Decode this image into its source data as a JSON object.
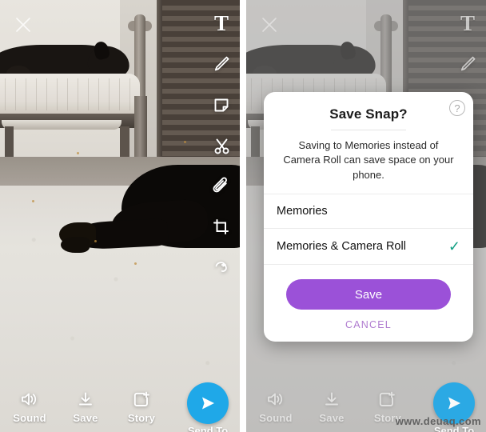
{
  "panels": {
    "left": {
      "name": "Snap editor",
      "close_icon": "close-x-icon",
      "tools": [
        {
          "id": "text",
          "icon": "text-tool-icon",
          "glyph": "T"
        },
        {
          "id": "draw",
          "icon": "pencil-icon"
        },
        {
          "id": "sticker",
          "icon": "sticker-icon"
        },
        {
          "id": "scissors",
          "icon": "scissors-icon"
        },
        {
          "id": "attach",
          "icon": "paperclip-icon"
        },
        {
          "id": "crop",
          "icon": "crop-icon"
        },
        {
          "id": "loop",
          "icon": "loop-icon"
        }
      ],
      "bottom": {
        "items": [
          {
            "id": "sound",
            "label": "Sound",
            "icon": "speaker-icon"
          },
          {
            "id": "save",
            "label": "Save",
            "icon": "download-icon"
          },
          {
            "id": "story",
            "label": "Story",
            "icon": "add-to-story-icon"
          }
        ],
        "send": {
          "label": "Send To",
          "icon": "send-arrow-icon",
          "color": "#1FA8E8"
        }
      }
    },
    "right": {
      "name": "Snap editor with Save Snap dialog",
      "dialog": {
        "title": "Save Snap?",
        "subtitle": "Saving to Memories instead of Camera Roll can save space on your phone.",
        "help_icon": "question-mark-icon",
        "help_glyph": "?",
        "options": [
          {
            "label": "Memories",
            "selected": false
          },
          {
            "label": "Memories & Camera Roll",
            "selected": true,
            "check_glyph": "✓"
          }
        ],
        "save_label": "Save",
        "cancel_label": "CANCEL",
        "colors": {
          "save_button": "#9B51D8",
          "cancel_text": "#B07CD0",
          "check": "#16A085"
        }
      }
    }
  },
  "watermark": "www.deuaq.com"
}
